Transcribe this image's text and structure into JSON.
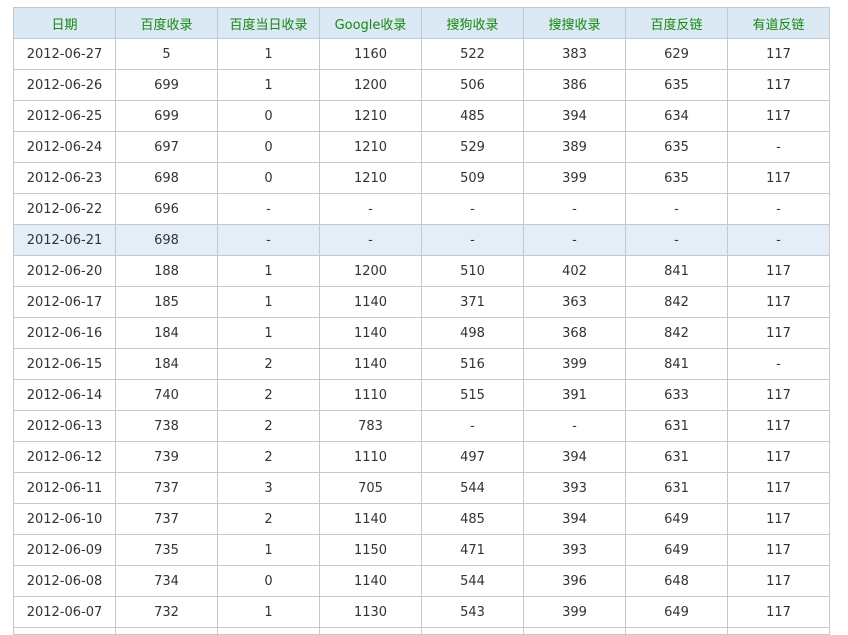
{
  "table": {
    "headers": [
      "日期",
      "百度收录",
      "百度当日收录",
      "Google收录",
      "搜狗收录",
      "搜搜收录",
      "百度反链",
      "有道反链"
    ],
    "highlight_row": "2012-06-21",
    "rows": [
      [
        "2012-06-27",
        "5",
        "1",
        "1160",
        "522",
        "383",
        "629",
        "117"
      ],
      [
        "2012-06-26",
        "699",
        "1",
        "1200",
        "506",
        "386",
        "635",
        "117"
      ],
      [
        "2012-06-25",
        "699",
        "0",
        "1210",
        "485",
        "394",
        "634",
        "117"
      ],
      [
        "2012-06-24",
        "697",
        "0",
        "1210",
        "529",
        "389",
        "635",
        "-"
      ],
      [
        "2012-06-23",
        "698",
        "0",
        "1210",
        "509",
        "399",
        "635",
        "117"
      ],
      [
        "2012-06-22",
        "696",
        "-",
        "-",
        "-",
        "-",
        "-",
        "-"
      ],
      [
        "2012-06-21",
        "698",
        "-",
        "-",
        "-",
        "-",
        "-",
        "-"
      ],
      [
        "2012-06-20",
        "188",
        "1",
        "1200",
        "510",
        "402",
        "841",
        "117"
      ],
      [
        "2012-06-17",
        "185",
        "1",
        "1140",
        "371",
        "363",
        "842",
        "117"
      ],
      [
        "2012-06-16",
        "184",
        "1",
        "1140",
        "498",
        "368",
        "842",
        "117"
      ],
      [
        "2012-06-15",
        "184",
        "2",
        "1140",
        "516",
        "399",
        "841",
        "-"
      ],
      [
        "2012-06-14",
        "740",
        "2",
        "1110",
        "515",
        "391",
        "633",
        "117"
      ],
      [
        "2012-06-13",
        "738",
        "2",
        "783",
        "-",
        "-",
        "631",
        "117"
      ],
      [
        "2012-06-12",
        "739",
        "2",
        "1110",
        "497",
        "394",
        "631",
        "117"
      ],
      [
        "2012-06-11",
        "737",
        "3",
        "705",
        "544",
        "393",
        "631",
        "117"
      ],
      [
        "2012-06-10",
        "737",
        "2",
        "1140",
        "485",
        "394",
        "649",
        "117"
      ],
      [
        "2012-06-09",
        "735",
        "1",
        "1150",
        "471",
        "393",
        "649",
        "117"
      ],
      [
        "2012-06-08",
        "734",
        "0",
        "1140",
        "544",
        "396",
        "648",
        "117"
      ],
      [
        "2012-06-07",
        "732",
        "1",
        "1130",
        "543",
        "399",
        "649",
        "117"
      ]
    ]
  }
}
